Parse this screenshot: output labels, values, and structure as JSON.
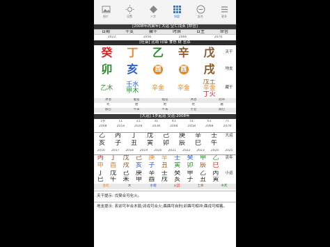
{
  "toolbar": {
    "items": [
      {
        "label": "图片",
        "icon": "image-icon"
      },
      {
        "label": "设置",
        "icon": "sun-icon"
      },
      {
        "label": "八字",
        "icon": "diamond-icon"
      },
      {
        "label": "排盘",
        "icon": "grid-icon"
      },
      {
        "label": "起名",
        "icon": "minus-circle-icon"
      },
      {
        "label": "更多",
        "icon": "list-icon"
      }
    ],
    "active_index": 3
  },
  "top_banner": "[2008年丙寅年]  大运  空亡戌亥  [命宫]",
  "header_row": [
    "日期",
    "干支",
    "藏干",
    "时辰",
    "日主",
    "命宫"
  ],
  "year_row": [
    "2022",
    "2056",
    "2066",
    "2076"
  ],
  "subtitle_banner": "[旺衰] 比劫 印枭 食伤 财 官杀",
  "gan_row": {
    "label": "天干",
    "chars": [
      "癸",
      "丁",
      "乙",
      "辛",
      "戊"
    ]
  },
  "zhi_row": {
    "label": "地支",
    "chars": [
      "卯",
      "亥",
      "酉",
      "酉",
      "戌"
    ]
  },
  "canggan_label": "藏干",
  "canggan": [
    [
      "乙木",
      ""
    ],
    [
      "壬水",
      "甲木"
    ],
    [
      "辛金",
      ""
    ],
    [
      "辛金",
      ""
    ],
    [
      "戊土",
      "辛金",
      "丁火"
    ]
  ],
  "shensha_row": [
    "沐浴",
    "临官",
    "临官",
    "沐浴",
    "冠带"
  ],
  "xingyun_row": [
    "死",
    "胎",
    "绝",
    "绝",
    "墓"
  ],
  "kongwang_row": [
    "辰巳",
    "午未",
    "午未",
    "子丑",
    "辰巳"
  ],
  "dayun_banner": "[大运] 1岁起运  交运:2008年",
  "dayun_years": [
    "2008",
    "2018",
    "2028",
    "2038",
    "2048",
    "2058",
    "2068",
    "2078"
  ],
  "dayun_ages": [
    "1岁",
    "11",
    "21",
    "31",
    "41",
    "51",
    "61",
    "71"
  ],
  "dayun_gan": [
    "乙",
    "丙",
    "丁",
    "戊",
    "己",
    "庚",
    "辛",
    "壬"
  ],
  "dayun_zhi": [
    "亥",
    "子",
    "丑",
    "寅",
    "卯",
    "辰",
    "巳",
    "午"
  ],
  "dayun_label": "大运",
  "liunian_years": [
    "2016",
    "2017",
    "2018",
    "2019",
    "2020",
    "2021",
    "2022",
    "2023",
    "2024",
    "2025"
  ],
  "liunian_gan": [
    "丙",
    "丁",
    "戊",
    "己",
    "庚",
    "辛",
    "壬",
    "癸",
    "甲",
    "乙"
  ],
  "liunian_zhi": [
    "申",
    "酉",
    "戌",
    "亥",
    "子",
    "丑",
    "寅",
    "卯",
    "辰",
    "巳"
  ],
  "liunian_label": "流年",
  "xiaoyun_gan": [
    "丁",
    "戊",
    "己",
    "庚",
    "辛",
    "壬",
    "癸",
    "甲",
    "乙",
    "丙"
  ],
  "xiaoyun_zhi": [
    "巳",
    "午",
    "未",
    "申",
    "酉",
    "戌",
    "亥",
    "子",
    "丑",
    "寅"
  ],
  "xiaoyun_label": "小运",
  "wuxing_row": [
    "金旺",
    "木",
    "水相",
    "火囚",
    "土休",
    "木死"
  ],
  "tiangan_hint_label": "天干提示:",
  "tiangan_hint": "戊癸合可化火。",
  "dizhi_hint_label": "地支提示:",
  "dizhi_hint": "亥卯可半合木局;卯戌可合火;酉酉可自刑;卯酉可相冲;酉戌可相害。",
  "colors": {
    "accent": "#2c6fd6",
    "orange": "#e48a2a",
    "red": "#d22222",
    "green": "#2a8a2a"
  }
}
